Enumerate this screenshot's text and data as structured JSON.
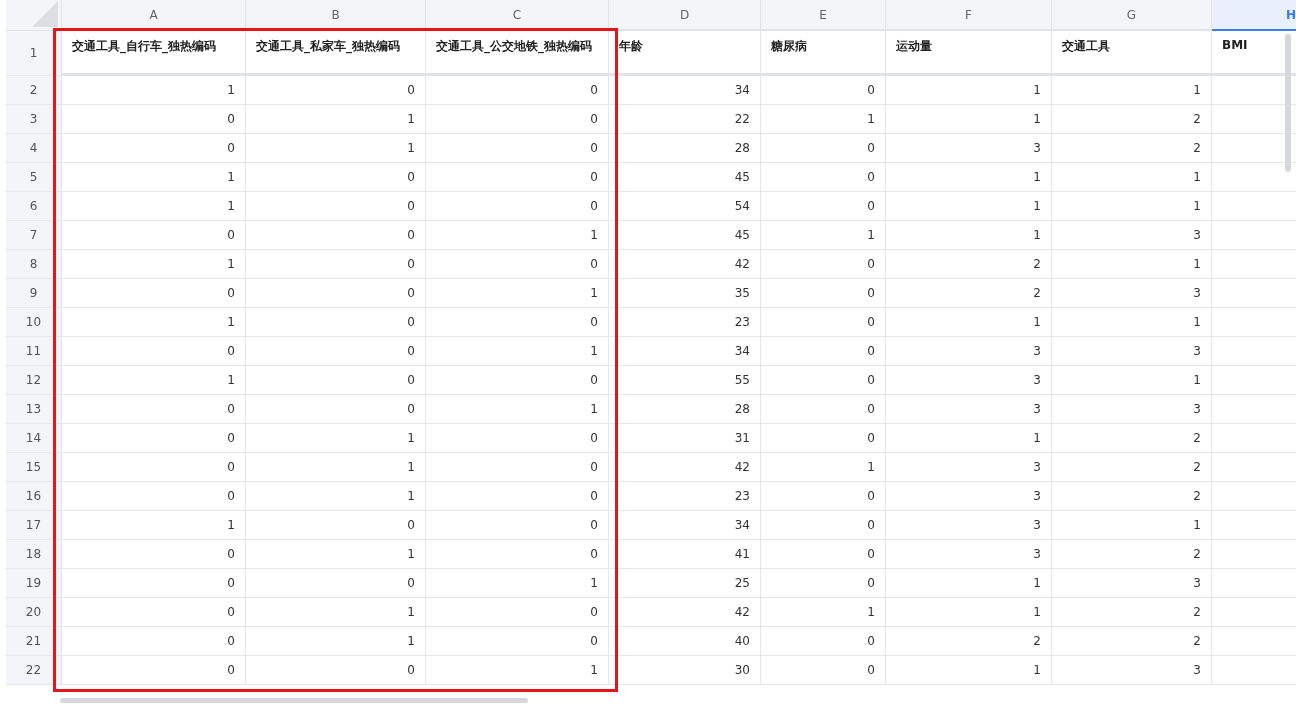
{
  "highlighted_columns": [
    {
      "letter": "A",
      "header": "交通工具_自行车_独热编码",
      "selected": false
    },
    {
      "letter": "B",
      "header": "交通工具_私家车_独热编码",
      "selected": false
    },
    {
      "letter": "C",
      "header": "交通工具_公交地铁_独热编码",
      "selected": false
    }
  ],
  "columns": [
    {
      "letter": "D",
      "header": "年龄",
      "selected": false
    },
    {
      "letter": "E",
      "header": "糖尿病",
      "selected": false
    },
    {
      "letter": "F",
      "header": "运动量",
      "selected": false
    },
    {
      "letter": "G",
      "header": "交通工具",
      "selected": false
    },
    {
      "letter": "H",
      "header": "BMI",
      "selected": true
    }
  ],
  "header_row_number": "1",
  "rows": [
    {
      "number": "2",
      "cells": [
        "1",
        "0",
        "0",
        "34",
        "0",
        "1",
        "1"
      ]
    },
    {
      "number": "3",
      "cells": [
        "0",
        "1",
        "0",
        "22",
        "1",
        "1",
        "2"
      ]
    },
    {
      "number": "4",
      "cells": [
        "0",
        "1",
        "0",
        "28",
        "0",
        "3",
        "2"
      ]
    },
    {
      "number": "5",
      "cells": [
        "1",
        "0",
        "0",
        "45",
        "0",
        "1",
        "1"
      ]
    },
    {
      "number": "6",
      "cells": [
        "1",
        "0",
        "0",
        "54",
        "0",
        "1",
        "1"
      ]
    },
    {
      "number": "7",
      "cells": [
        "0",
        "0",
        "1",
        "45",
        "1",
        "1",
        "3"
      ]
    },
    {
      "number": "8",
      "cells": [
        "1",
        "0",
        "0",
        "42",
        "0",
        "2",
        "1"
      ]
    },
    {
      "number": "9",
      "cells": [
        "0",
        "0",
        "1",
        "35",
        "0",
        "2",
        "3"
      ]
    },
    {
      "number": "10",
      "cells": [
        "1",
        "0",
        "0",
        "23",
        "0",
        "1",
        "1"
      ]
    },
    {
      "number": "11",
      "cells": [
        "0",
        "0",
        "1",
        "34",
        "0",
        "3",
        "3"
      ]
    },
    {
      "number": "12",
      "cells": [
        "1",
        "0",
        "0",
        "55",
        "0",
        "3",
        "1"
      ]
    },
    {
      "number": "13",
      "cells": [
        "0",
        "0",
        "1",
        "28",
        "0",
        "3",
        "3"
      ]
    },
    {
      "number": "14",
      "cells": [
        "0",
        "1",
        "0",
        "31",
        "0",
        "1",
        "2"
      ]
    },
    {
      "number": "15",
      "cells": [
        "0",
        "1",
        "0",
        "42",
        "1",
        "3",
        "2"
      ]
    },
    {
      "number": "16",
      "cells": [
        "0",
        "1",
        "0",
        "23",
        "0",
        "3",
        "2"
      ]
    },
    {
      "number": "17",
      "cells": [
        "1",
        "0",
        "0",
        "34",
        "0",
        "3",
        "1"
      ]
    },
    {
      "number": "18",
      "cells": [
        "0",
        "1",
        "0",
        "41",
        "0",
        "3",
        "2"
      ]
    },
    {
      "number": "19",
      "cells": [
        "0",
        "0",
        "1",
        "25",
        "0",
        "1",
        "3"
      ]
    },
    {
      "number": "20",
      "cells": [
        "0",
        "1",
        "0",
        "42",
        "1",
        "1",
        "2"
      ]
    },
    {
      "number": "21",
      "cells": [
        "0",
        "1",
        "0",
        "40",
        "0",
        "2",
        "2"
      ]
    },
    {
      "number": "22",
      "cells": [
        "0",
        "0",
        "1",
        "30",
        "0",
        "1",
        "3"
      ]
    }
  ]
}
